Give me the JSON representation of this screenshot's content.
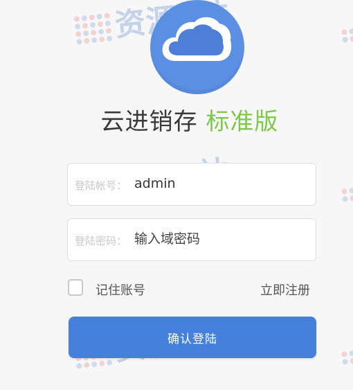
{
  "app": {
    "title_main": "云进销存",
    "title_edition": "标准版",
    "logo_icon": "cloud-icon"
  },
  "watermark": {
    "text": "资源E站"
  },
  "login": {
    "account_label": "登陆帐号：",
    "account_value": "admin",
    "password_label": "登陆密码：",
    "password_placeholder": "输入域密码",
    "remember_label": "记住账号",
    "register_link": "立即注册",
    "submit_label": "确认登陆"
  },
  "colors": {
    "accent": "#4581db",
    "edition": "#7ec84a",
    "logo_bg": "#5b8fe3"
  }
}
